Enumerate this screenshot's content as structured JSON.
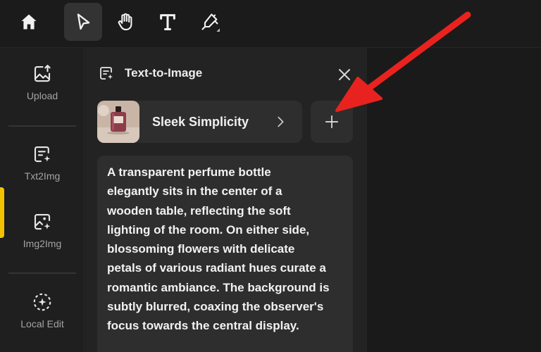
{
  "toolbar": {
    "tools": [
      "home-icon",
      "select-arrow-icon",
      "hand-icon",
      "text-icon",
      "highlighter-icon"
    ],
    "active_tool": "select-arrow-icon"
  },
  "rail": {
    "items": [
      {
        "label": "Upload",
        "icon": "upload-image-icon"
      },
      {
        "label": "Txt2Img",
        "icon": "text-to-image-icon",
        "active": true
      },
      {
        "label": "Img2Img",
        "icon": "image-to-image-icon"
      },
      {
        "label": "Local Edit",
        "icon": "local-edit-icon"
      }
    ]
  },
  "panel": {
    "title": "Text-to-Image",
    "style_name": "Sleek Simplicity",
    "prompt": "A transparent perfume bottle\nelegantly sits in the center of a\nwooden table, reflecting the soft\nlighting of the room. On either side,\nblossoming flowers with delicate\npetals of various radiant hues curate a\nromantic ambiance. The background is\nsubtly blurred, coaxing the observer's\nfocus towards the central display."
  },
  "colors": {
    "accent": "#f3c200",
    "annotation_arrow": "#e8231f"
  }
}
